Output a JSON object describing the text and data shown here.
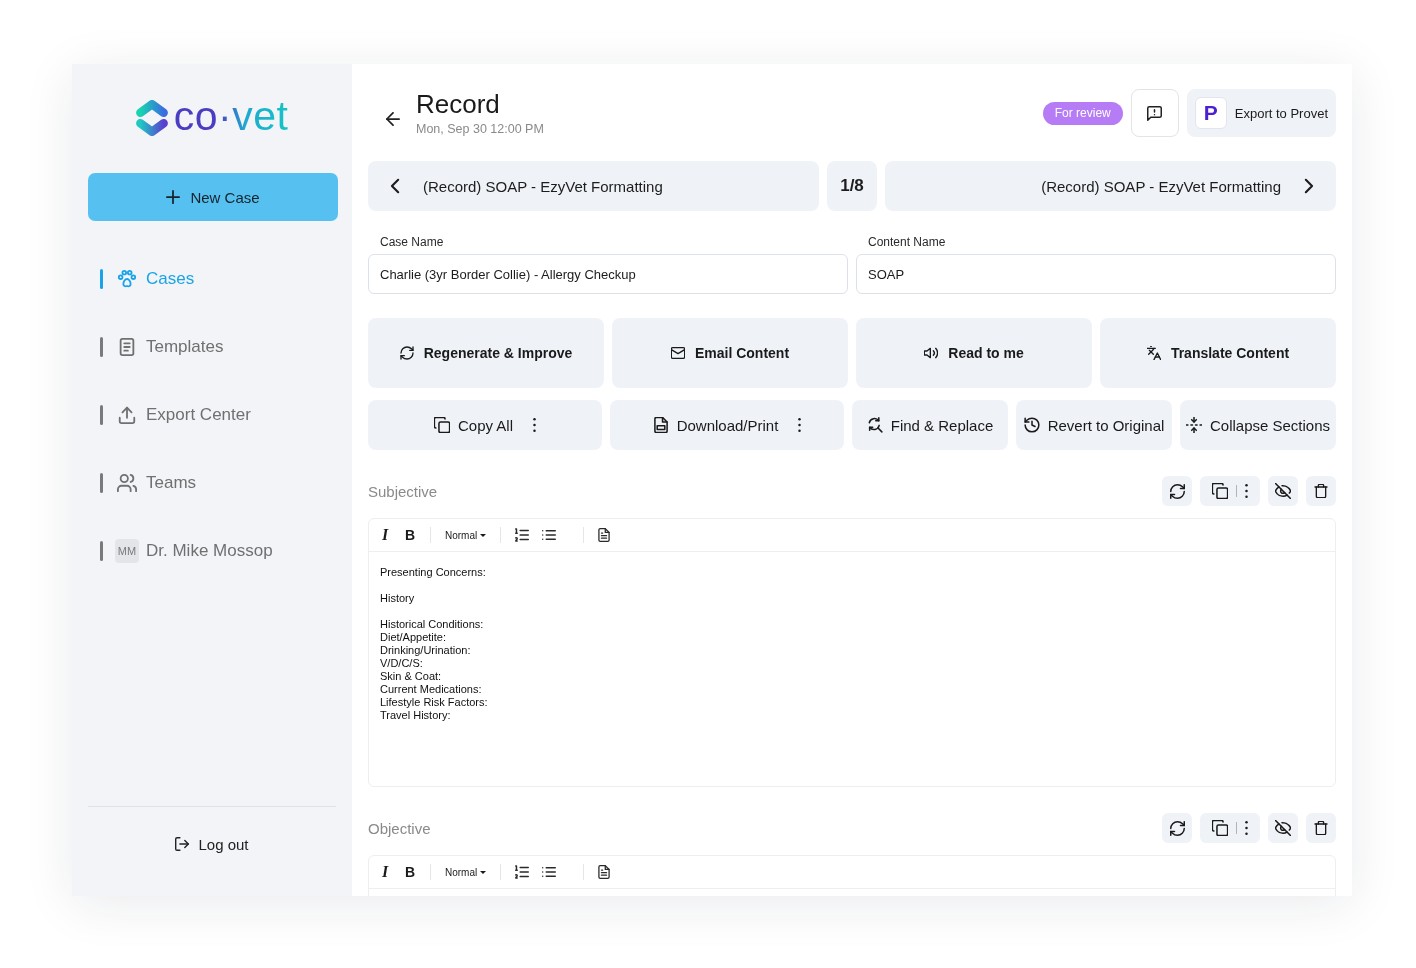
{
  "sidebar": {
    "logo": "co·vet",
    "new_case": "New Case",
    "nav": [
      {
        "kind": "link",
        "label": "Cases",
        "selected": true
      },
      {
        "kind": "link",
        "label": "Templates",
        "selected": false
      },
      {
        "kind": "link",
        "label": "Export Center",
        "selected": false
      },
      {
        "kind": "link",
        "label": "Teams",
        "selected": false
      },
      {
        "kind": "user",
        "initials": "MM",
        "label": "Dr. Mike Mossop",
        "selected": false
      }
    ],
    "logout": "Log out"
  },
  "header": {
    "title": "Record",
    "date": "Mon, Sep 30 12:00 PM",
    "status": "For review",
    "export_button": {
      "logo": "P",
      "label": "Export to Provet"
    }
  },
  "template_nav": {
    "previous": "(Record) SOAP - EzyVet Formatting",
    "position": "1/8",
    "next": "(Record) SOAP - EzyVet Formatting"
  },
  "fields": [
    {
      "label": "Case Name",
      "value": "Charlie (3yr Border Collie) - Allergy Checkup"
    },
    {
      "label": "Content Name",
      "value": "SOAP"
    }
  ],
  "actions": [
    {
      "label": "Regenerate & Improve"
    },
    {
      "label": "Email Content"
    },
    {
      "label": "Read to me"
    },
    {
      "label": "Translate Content"
    }
  ],
  "tools": [
    {
      "label": "Copy All",
      "menu": true
    },
    {
      "label": "Download/Print",
      "menu": true
    },
    {
      "label": "Find & Replace",
      "menu": false
    },
    {
      "label": "Revert to Original",
      "menu": false
    },
    {
      "label": "Collapse Sections",
      "menu": false
    }
  ],
  "sections": [
    {
      "title": "Subjective",
      "toolbar": {
        "italic": "I",
        "bold": "B",
        "format": "Normal"
      },
      "paragraphs": [
        [
          "Presenting Concerns:"
        ],
        [
          "History"
        ],
        [
          "Historical Conditions:",
          "Diet/Appetite:",
          "Drinking/Urination:",
          "V/D/C/S:",
          "Skin & Coat:",
          "Current Medications:",
          "Lifestyle Risk Factors:",
          "Travel History:"
        ]
      ]
    },
    {
      "title": "Objective",
      "toolbar": {
        "italic": "I",
        "bold": "B",
        "format": "Normal"
      }
    }
  ]
}
